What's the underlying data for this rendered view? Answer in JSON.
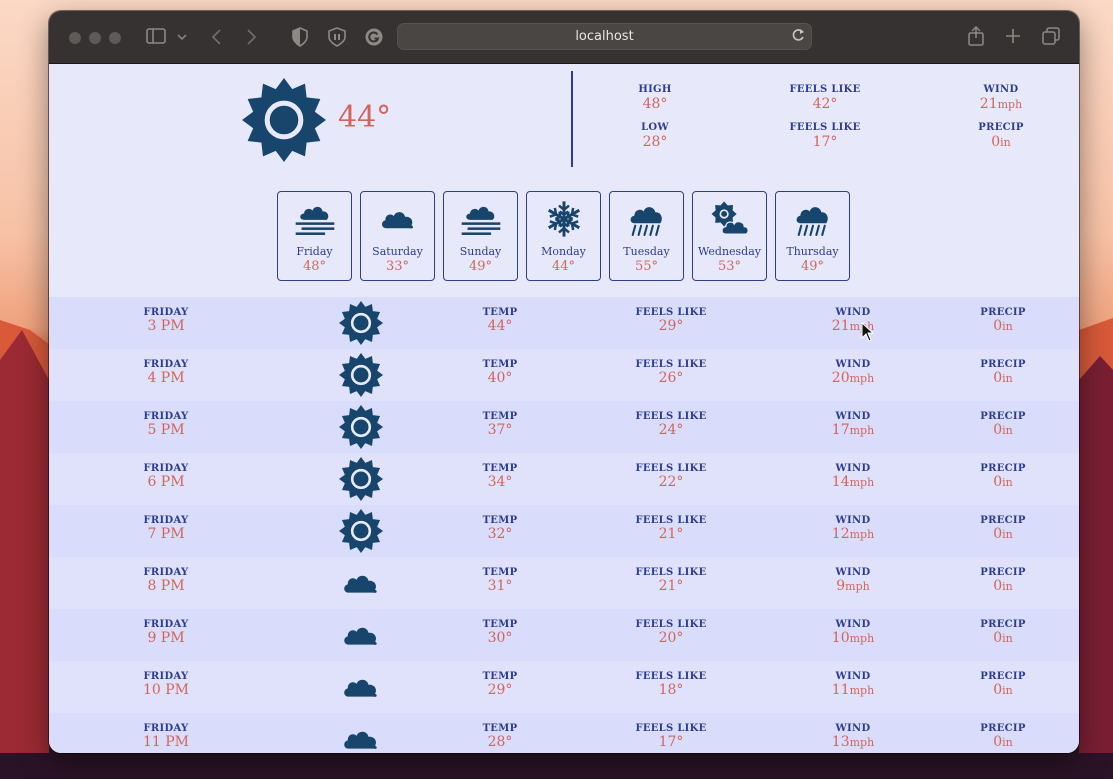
{
  "browser": {
    "url": "localhost"
  },
  "current": {
    "icon": "sun-icon",
    "temp": "44°",
    "stats": [
      {
        "label": "HIGH",
        "value": "48°",
        "unit": ""
      },
      {
        "label": "FEELS LIKE",
        "value": "42°",
        "unit": ""
      },
      {
        "label": "WIND",
        "value": "21",
        "unit": "mph"
      },
      {
        "label": "LOW",
        "value": "28°",
        "unit": ""
      },
      {
        "label": "FEELS LIKE",
        "value": "17°",
        "unit": ""
      },
      {
        "label": "PRECIP",
        "value": "0",
        "unit": "in"
      }
    ]
  },
  "daily": [
    {
      "day": "Friday",
      "temp": "48°",
      "icon": "fog-cloud-icon"
    },
    {
      "day": "Saturday",
      "temp": "33°",
      "icon": "cloud-icon"
    },
    {
      "day": "Sunday",
      "temp": "49°",
      "icon": "fog-cloud-icon"
    },
    {
      "day": "Monday",
      "temp": "44°",
      "icon": "snowflake-icon"
    },
    {
      "day": "Tuesday",
      "temp": "55°",
      "icon": "rain-cloud-icon"
    },
    {
      "day": "Wednesday",
      "temp": "53°",
      "icon": "partly-cloudy-icon"
    },
    {
      "day": "Thursday",
      "temp": "49°",
      "icon": "rain-cloud-icon"
    }
  ],
  "hourly_labels": {
    "temp": "TEMP",
    "feels_like": "FEELS LIKE",
    "wind": "WIND",
    "precip": "PRECIP",
    "wind_unit": "mph",
    "precip_unit": "in"
  },
  "hourly": [
    {
      "day": "FRIDAY",
      "time": "3 PM",
      "icon": "sun-icon",
      "temp": "44°",
      "feels": "29°",
      "wind": "21",
      "precip": "0"
    },
    {
      "day": "FRIDAY",
      "time": "4 PM",
      "icon": "sun-icon",
      "temp": "40°",
      "feels": "26°",
      "wind": "20",
      "precip": "0"
    },
    {
      "day": "FRIDAY",
      "time": "5 PM",
      "icon": "sun-icon",
      "temp": "37°",
      "feels": "24°",
      "wind": "17",
      "precip": "0"
    },
    {
      "day": "FRIDAY",
      "time": "6 PM",
      "icon": "sun-icon",
      "temp": "34°",
      "feels": "22°",
      "wind": "14",
      "precip": "0"
    },
    {
      "day": "FRIDAY",
      "time": "7 PM",
      "icon": "sun-icon",
      "temp": "32°",
      "feels": "21°",
      "wind": "12",
      "precip": "0"
    },
    {
      "day": "FRIDAY",
      "time": "8 PM",
      "icon": "cloud-icon",
      "temp": "31°",
      "feels": "21°",
      "wind": "9",
      "precip": "0"
    },
    {
      "day": "FRIDAY",
      "time": "9 PM",
      "icon": "cloud-icon",
      "temp": "30°",
      "feels": "20°",
      "wind": "10",
      "precip": "0"
    },
    {
      "day": "FRIDAY",
      "time": "10 PM",
      "icon": "cloud-icon",
      "temp": "29°",
      "feels": "18°",
      "wind": "11",
      "precip": "0"
    },
    {
      "day": "FRIDAY",
      "time": "11 PM",
      "icon": "cloud-icon",
      "temp": "28°",
      "feels": "17°",
      "wind": "13",
      "precip": "0"
    }
  ]
}
